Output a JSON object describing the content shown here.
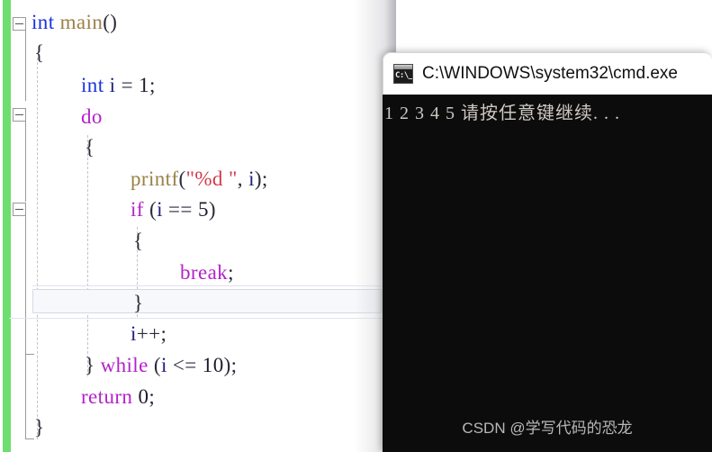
{
  "editor": {
    "change_bar_color": "#6ede70",
    "current_line_highlight_color": "#f7f8fc",
    "code_lines": [
      {
        "indent": 0,
        "text": "int main()"
      },
      {
        "indent": 0,
        "text": "{"
      },
      {
        "indent": 1,
        "text": "int i = 1;"
      },
      {
        "indent": 1,
        "text": "do"
      },
      {
        "indent": 1,
        "text": "{"
      },
      {
        "indent": 2,
        "text": "printf(\"%d \", i);"
      },
      {
        "indent": 2,
        "text": "if (i == 5)"
      },
      {
        "indent": 2,
        "text": "{"
      },
      {
        "indent": 3,
        "text": "break;"
      },
      {
        "indent": 2,
        "text": "}"
      },
      {
        "indent": 2,
        "text": "i++;"
      },
      {
        "indent": 1,
        "text": "} while (i <= 10);"
      },
      {
        "indent": 1,
        "text": "return 0;"
      },
      {
        "indent": 0,
        "text": "}"
      }
    ],
    "fold_markers": [
      {
        "line": "int main()",
        "state": "expanded"
      },
      {
        "line": "do",
        "state": "expanded"
      },
      {
        "line": "if (i == 5)",
        "state": "expanded"
      }
    ],
    "syntax_colors": {
      "keyword": "#b322c9",
      "type": "#1b32e0",
      "function": "#9a8147",
      "string": "#d03a4a",
      "variable": "#21217a",
      "plain": "#1b1b2b"
    }
  },
  "console": {
    "title": "C:\\WINDOWS\\system32\\cmd.exe",
    "icon": "cmd-console-icon",
    "icon_text": "C:\\_",
    "output": "1 2 3 4 5 请按任意键继续. . .",
    "background_color": "#0c0c0c",
    "text_color": "#ccc8c2",
    "watermark": "CSDN @学写代码的恐龙"
  }
}
